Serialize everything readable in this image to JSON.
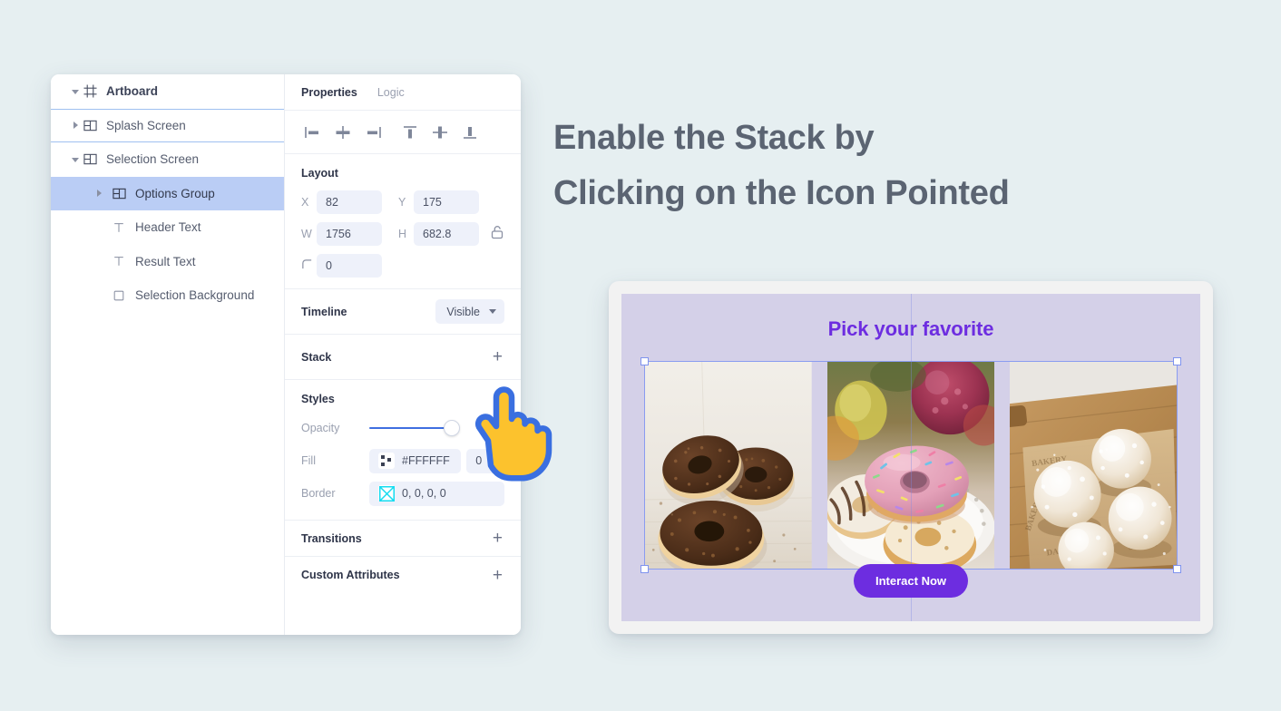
{
  "headline": {
    "line1": "Enable the Stack by",
    "line2": "Clicking on the Icon Pointed"
  },
  "layers": {
    "items": [
      {
        "label": "Artboard",
        "icon": "artboard-icon",
        "caret": "open",
        "indent": 0,
        "state": "normal"
      },
      {
        "label": "Splash Screen",
        "icon": "group-icon",
        "caret": "closed",
        "indent": 0,
        "state": "outlined"
      },
      {
        "label": "Selection Screen",
        "icon": "group-icon",
        "caret": "open",
        "indent": 0,
        "state": "normal"
      },
      {
        "label": "Options Group",
        "icon": "group-icon",
        "caret": "closed",
        "indent": 1,
        "state": "selected"
      },
      {
        "label": "Header Text",
        "icon": "text-icon",
        "caret": "none",
        "indent": 1,
        "state": "normal"
      },
      {
        "label": "Result Text",
        "icon": "text-icon",
        "caret": "none",
        "indent": 1,
        "state": "normal"
      },
      {
        "label": "Selection Background",
        "icon": "rect-icon",
        "caret": "none",
        "indent": 1,
        "state": "normal"
      }
    ]
  },
  "properties": {
    "tabs": [
      {
        "label": "Properties",
        "active": true
      },
      {
        "label": "Logic",
        "active": false
      }
    ],
    "align_icons": [
      "align-left-icon",
      "align-center-horizontal-icon",
      "align-right-icon",
      "align-top-icon",
      "align-center-vertical-icon",
      "align-bottom-icon"
    ],
    "layout": {
      "title": "Layout",
      "x_key": "X",
      "x_value": "82",
      "y_key": "Y",
      "y_value": "175",
      "w_key": "W",
      "w_value": "1756",
      "h_key": "H",
      "h_value": "682.8",
      "corner_value": "0",
      "lock_icon": "unlock-icon",
      "corner_icon": "corner-radius-icon"
    },
    "timeline": {
      "label": "Timeline",
      "value": "Visible"
    },
    "stack": {
      "label": "Stack",
      "add": "+"
    },
    "styles": {
      "title": "Styles",
      "opacity_label": "Opacity",
      "opacity_value": "100",
      "fill_label": "Fill",
      "fill_value": "#FFFFFF",
      "fill_alpha": "0",
      "fill_swatch_icon": "fill-swatch-icon",
      "border_label": "Border",
      "border_value": "0, 0, 0, 0",
      "border_swatch_icon": "no-color-swatch-icon"
    },
    "transitions": {
      "label": "Transitions",
      "add": "+"
    },
    "custom_attributes": {
      "label": "Custom Attributes",
      "add": "+"
    }
  },
  "preview": {
    "title": "Pick your favorite",
    "button_label": "Interact Now",
    "images": [
      {
        "alt": "chocolate-glazed-donuts"
      },
      {
        "alt": "pink-frosted-donut-stack"
      },
      {
        "alt": "powdered-sugar-donuts-on-board"
      }
    ]
  },
  "colors": {
    "page_background": "#e6eff1",
    "headline_text": "#5b6472",
    "accent_purple": "#6d2de0",
    "preview_stage": "#d4d0e8",
    "selected_row": "#bacdf5",
    "slider_blue": "#3f6fe0",
    "cursor_fill": "#fcc22d",
    "cursor_stroke": "#3a6fe0"
  },
  "cursor": {
    "icon": "pointing-hand-cursor"
  }
}
